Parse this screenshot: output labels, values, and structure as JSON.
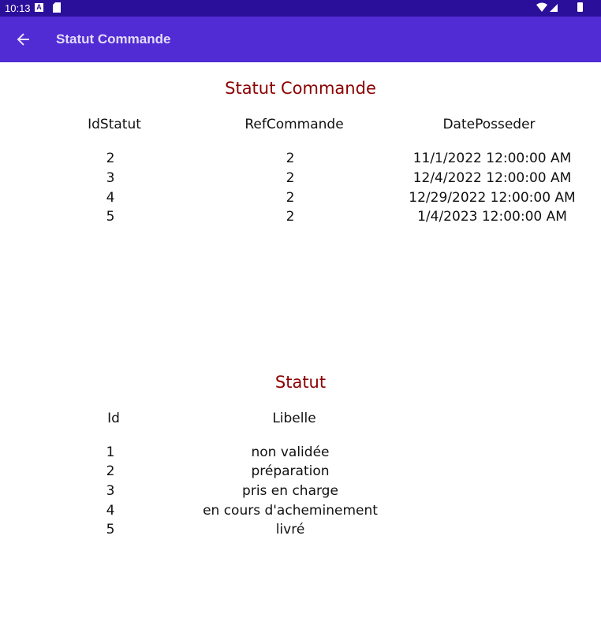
{
  "status_bar": {
    "time": "10:13",
    "notification_icons": [
      "a-badge-icon",
      "sd-card-icon"
    ],
    "system_icons": [
      "wifi-icon",
      "signal-icon",
      "battery-icon"
    ]
  },
  "app_bar": {
    "title": "Statut Commande",
    "back_icon": "arrow-left-icon"
  },
  "colors": {
    "status_bar": "#2a0f9a",
    "app_bar": "#512bd4",
    "section_title": "#8b0000"
  },
  "statut_commande": {
    "title": "Statut Commande",
    "headers": [
      "IdStatut",
      "RefCommande",
      "DatePosseder"
    ],
    "rows": [
      [
        "2",
        "2",
        "11/1/2022 12:00:00 AM"
      ],
      [
        "3",
        "2",
        "12/4/2022 12:00:00 AM"
      ],
      [
        "4",
        "2",
        "12/29/2022 12:00:00 AM"
      ],
      [
        "5",
        "2",
        "1/4/2023 12:00:00 AM"
      ]
    ]
  },
  "statut": {
    "title": "Statut",
    "headers": [
      "Id",
      "Libelle"
    ],
    "rows": [
      [
        "1",
        "non validée"
      ],
      [
        "2",
        "préparation"
      ],
      [
        "3",
        "pris en charge"
      ],
      [
        "4",
        "en cours d'acheminement"
      ],
      [
        "5",
        "livré"
      ]
    ]
  }
}
